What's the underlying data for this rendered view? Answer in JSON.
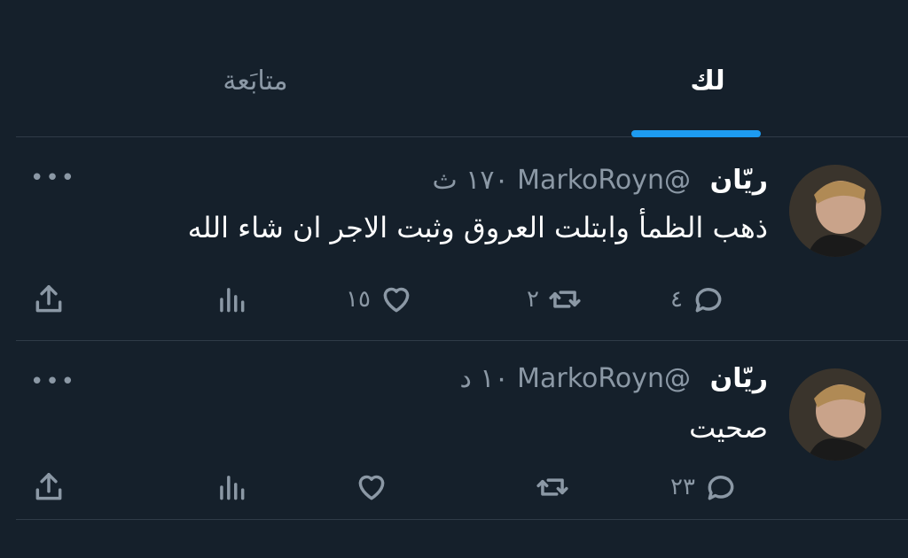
{
  "header": {
    "cut_title": ""
  },
  "tabs": [
    {
      "label": "لك",
      "selected": true
    },
    {
      "label": "متابَعة",
      "selected": false
    }
  ],
  "colors": {
    "background": "#15202b",
    "accent": "#1d9bf0",
    "muted": "#8b98a5",
    "divider": "#2f3b47"
  },
  "tweets": [
    {
      "name": "ريّان",
      "handle": "@MarkoRoyn",
      "time": "١٧٠ ث",
      "text": "ذهب الظمأ وابتلت العروق وثبت الاجر ان شاء الله",
      "replies": "٤",
      "retweets": "٢",
      "likes": "١٥",
      "views": "",
      "more_icon": "more-horizontal-icon"
    },
    {
      "name": "ريّان",
      "handle": "@MarkoRoyn",
      "time": "١٠ د",
      "text": "صحيت",
      "replies": "٢٣",
      "retweets": "",
      "likes": "",
      "views": "",
      "more_icon": "more-horizontal-icon"
    }
  ]
}
